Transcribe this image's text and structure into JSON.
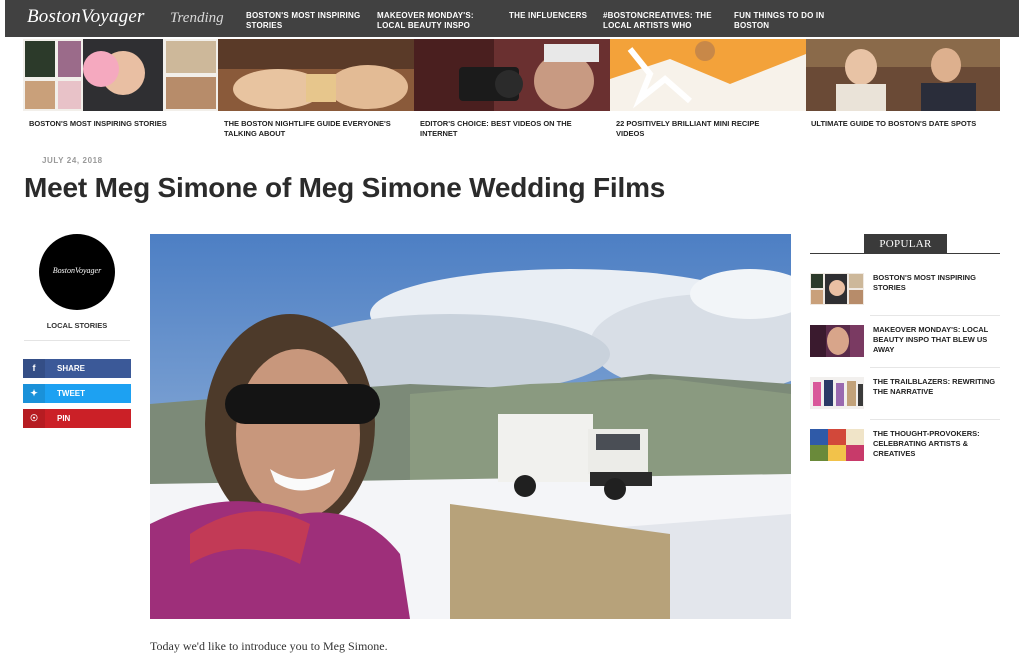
{
  "site": {
    "logo": "BostonVoyager",
    "trending_label": "Trending"
  },
  "nav": [
    "BOSTON'S MOST INSPIRING STORIES",
    "MAKEOVER MONDAY'S: LOCAL BEAUTY INSPO",
    "THE INFLUENCERS",
    "#BOSTONCREATIVES: THE LOCAL ARTISTS WHO",
    "FUN THINGS TO DO IN BOSTON"
  ],
  "featured": [
    "BOSTON'S MOST INSPIRING STORIES",
    "THE BOSTON NIGHTLIFE GUIDE EVERYONE'S TALKING ABOUT",
    "EDITOR'S CHOICE: BEST VIDEOS ON THE INTERNET",
    "22 POSITIVELY BRILLIANT MINI RECIPE VIDEOS",
    "ULTIMATE GUIDE TO BOSTON'S DATE SPOTS"
  ],
  "article": {
    "date": "JULY 24, 2018",
    "title": "Meet Meg Simone of Meg Simone Wedding Films",
    "intro": "Today we'd like to introduce you to Meg Simone."
  },
  "author": {
    "avatar_text": "BostonVoyager",
    "label": "LOCAL STORIES"
  },
  "share": [
    {
      "label": "SHARE",
      "icon": "facebook-icon",
      "color": "#3b5998"
    },
    {
      "label": "TWEET",
      "icon": "twitter-icon",
      "color": "#1da1f2"
    },
    {
      "label": "PIN",
      "icon": "pinterest-icon",
      "color": "#cb2027"
    }
  ],
  "popular": {
    "heading": "POPULAR",
    "items": [
      "BOSTON'S MOST INSPIRING STORIES",
      "MAKEOVER MONDAY'S: LOCAL BEAUTY INSPO THAT BLEW US AWAY",
      "THE TRAILBLAZERS: REWRITING THE NARRATIVE",
      "THE THOUGHT-PROVOKERS: CELEBRATING ARTISTS & CREATIVES"
    ]
  }
}
